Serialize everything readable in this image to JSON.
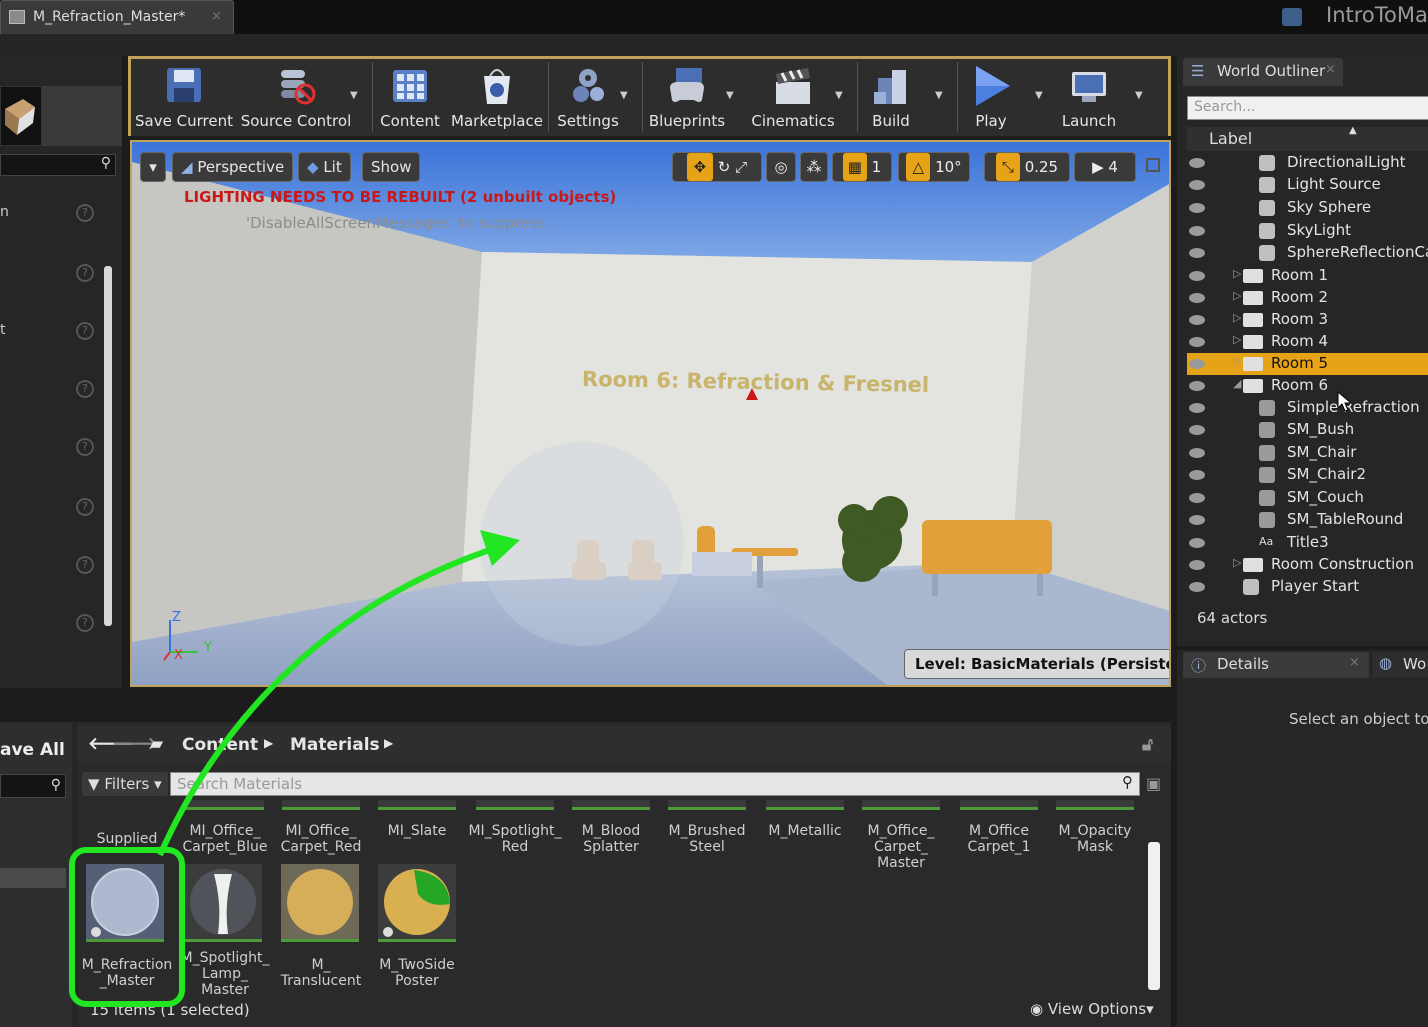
{
  "tab": {
    "title": "M_Refraction_Master*",
    "close": "×"
  },
  "project": {
    "name": "IntroToMat"
  },
  "left_panel": {
    "items": [
      "n",
      "t"
    ],
    "help": "?"
  },
  "toolbar": {
    "buttons": [
      {
        "label": "Save Current",
        "icon": "save-icon"
      },
      {
        "label": "Source Control",
        "icon": "source-control-icon"
      },
      {
        "label": "Content",
        "icon": "content-icon"
      },
      {
        "label": "Marketplace",
        "icon": "marketplace-icon"
      },
      {
        "label": "Settings",
        "icon": "settings-icon"
      },
      {
        "label": "Blueprints",
        "icon": "blueprints-icon"
      },
      {
        "label": "Cinematics",
        "icon": "cinematics-icon"
      },
      {
        "label": "Build",
        "icon": "build-icon"
      },
      {
        "label": "Play",
        "icon": "play-icon"
      },
      {
        "label": "Launch",
        "icon": "launch-icon"
      }
    ]
  },
  "viewport": {
    "perspective": "Perspective",
    "lit": "Lit",
    "show": "Show",
    "warning": "LIGHTING NEEDS TO BE REBUILT (2 unbuilt objects)",
    "suppress": "'DisableAllScreenMessages' to suppress",
    "room_title": "Room 6: Refraction & Fresnel",
    "level": "Level:  BasicMaterials (Persistent)",
    "grid_value": "1",
    "rot_value": "10°",
    "scale_value": "0.25",
    "cam_speed": "4",
    "axis_z": "Z",
    "axis_x": "X",
    "axis_y": "Y"
  },
  "outliner": {
    "tab": "World Outliner",
    "close": "×",
    "search_placeholder": "Search...",
    "column": "Label",
    "rows": [
      {
        "label": "DirectionalLight",
        "type": "actor"
      },
      {
        "label": "Light Source",
        "type": "actor"
      },
      {
        "label": "Sky Sphere",
        "type": "actor"
      },
      {
        "label": "SkyLight",
        "type": "actor"
      },
      {
        "label": "SphereReflectionCap",
        "type": "actor"
      },
      {
        "label": "Room 1",
        "type": "folder"
      },
      {
        "label": "Room 2",
        "type": "folder"
      },
      {
        "label": "Room 3",
        "type": "folder"
      },
      {
        "label": "Room 4",
        "type": "folder"
      },
      {
        "label": "Room 5",
        "type": "folder",
        "selected": true
      },
      {
        "label": "Room 6",
        "type": "folder",
        "expanded": true
      },
      {
        "label": "Simple Refraction",
        "type": "actor"
      },
      {
        "label": "SM_Bush",
        "type": "actor"
      },
      {
        "label": "SM_Chair",
        "type": "actor"
      },
      {
        "label": "SM_Chair2",
        "type": "actor"
      },
      {
        "label": "SM_Couch",
        "type": "actor"
      },
      {
        "label": "SM_TableRound",
        "type": "actor"
      },
      {
        "label": "Title3",
        "type": "actor"
      },
      {
        "label": "Room Construction",
        "type": "folder"
      },
      {
        "label": "Player Start",
        "type": "actor"
      }
    ],
    "count": "64 actors"
  },
  "details": {
    "tab": "Details",
    "close": "×",
    "tab2": "Wo",
    "hint": "Select an object to v"
  },
  "content_browser": {
    "save_all": "ave All",
    "path": [
      "Content",
      "Materials"
    ],
    "filters": "Filters",
    "search_placeholder": "Search Materials",
    "row1": [
      "Supplied",
      "MI_Office_\nCarpet_Blue",
      "MI_Office_\nCarpet_Red",
      "MI_Slate",
      "MI_Spotlight_\nRed",
      "M_Blood\nSplatter",
      "M_Brushed\nSteel",
      "M_Metallic",
      "M_Office_\nCarpet_\nMaster",
      "M_Office\nCarpet_1",
      "M_Opacity\nMask"
    ],
    "row2": [
      "M_Refraction\n_Master",
      "M_Spotlight_\nLamp_\nMaster",
      "M_\nTranslucent",
      "M_TwoSide\nPoster"
    ],
    "status": "15 items (1 selected)",
    "view_options": "View Options"
  },
  "colors": {
    "accent": "#e6a317",
    "frame": "#c2a25a",
    "annotation": "#22e622",
    "warning": "#c81818"
  }
}
